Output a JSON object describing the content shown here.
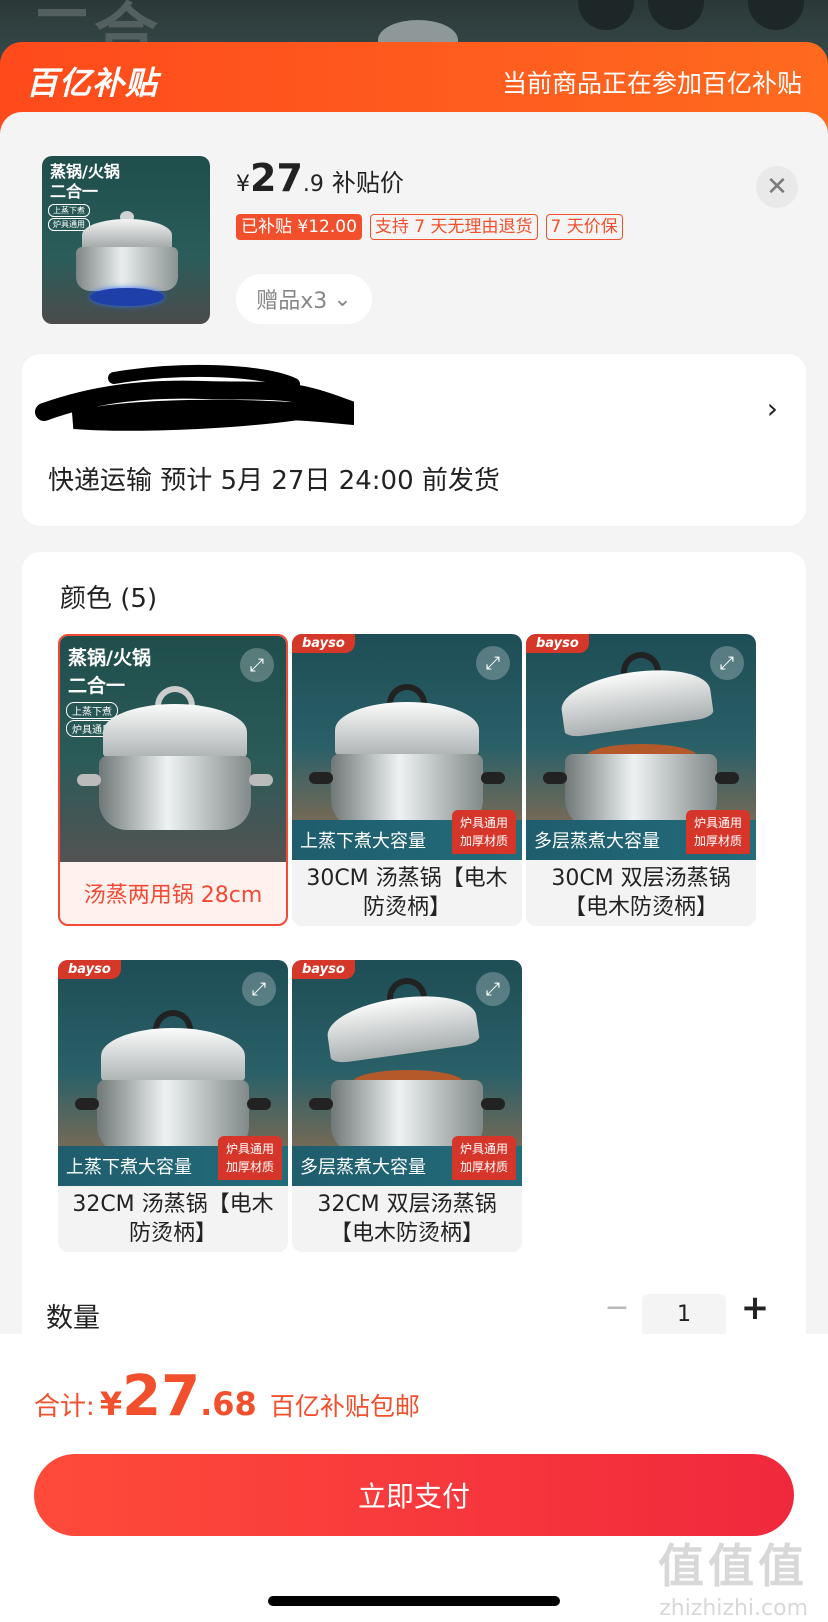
{
  "header": {
    "brand": "百亿补贴",
    "note": "当前商品正在参加百亿补贴"
  },
  "product": {
    "thumb_title": "蒸锅/火锅\n二合一",
    "thumb_tags": [
      "上蒸下煮",
      "炉具通用"
    ],
    "price_currency": "¥",
    "price_int": "27",
    "price_dec": ".9",
    "price_label": "补贴价",
    "badges": [
      "已补贴 ¥12.00",
      "支持 7 天无理由退货",
      "7 天价保"
    ],
    "gift_label": "赠品x3",
    "close_icon": "close-icon"
  },
  "address": {
    "arrow": "›",
    "shipping": "快递运输 预计 5月 27日 24:00 前发货"
  },
  "options": {
    "section_title": "颜色 (5)",
    "variants": [
      {
        "label": "汤蒸两用锅 28cm",
        "title": "蒸锅/火锅\n二合一",
        "tags": [
          "上蒸下煮",
          "炉具通用"
        ],
        "selected": true
      },
      {
        "label": "30CM 汤蒸锅【电木防烫柄】",
        "logo": "bayso",
        "banner": "上蒸下煮大容量",
        "box": "炉具通用\n加厚材质"
      },
      {
        "label": "30CM 双层汤蒸锅【电木防烫柄】",
        "logo": "bayso",
        "banner": "多层蒸煮大容量",
        "box": "炉具通用\n加厚材质"
      },
      {
        "label": "32CM 汤蒸锅【电木防烫柄】",
        "logo": "bayso",
        "banner": "上蒸下煮大容量",
        "box": "炉具通用\n加厚材质"
      },
      {
        "label": "32CM 双层汤蒸锅【电木防烫柄】",
        "logo": "bayso",
        "banner": "多层蒸煮大容量",
        "box": "炉具通用\n加厚材质"
      }
    ],
    "expand_icon": "⤢"
  },
  "quantity": {
    "label": "数量",
    "minus": "−",
    "value": "1",
    "plus": "+"
  },
  "footer": {
    "total_label": "合计:",
    "total_currency": "¥",
    "total_int": "27",
    "total_dec": ".68",
    "total_note": "百亿补贴包邮",
    "pay_button": "立即支付",
    "watermark_big": "值值值",
    "watermark_small": "zhizhizhi.com"
  },
  "colors": {
    "accent": "#f2502d",
    "pay_button": "#f0283d",
    "header_orange": "#ff4a1c"
  }
}
